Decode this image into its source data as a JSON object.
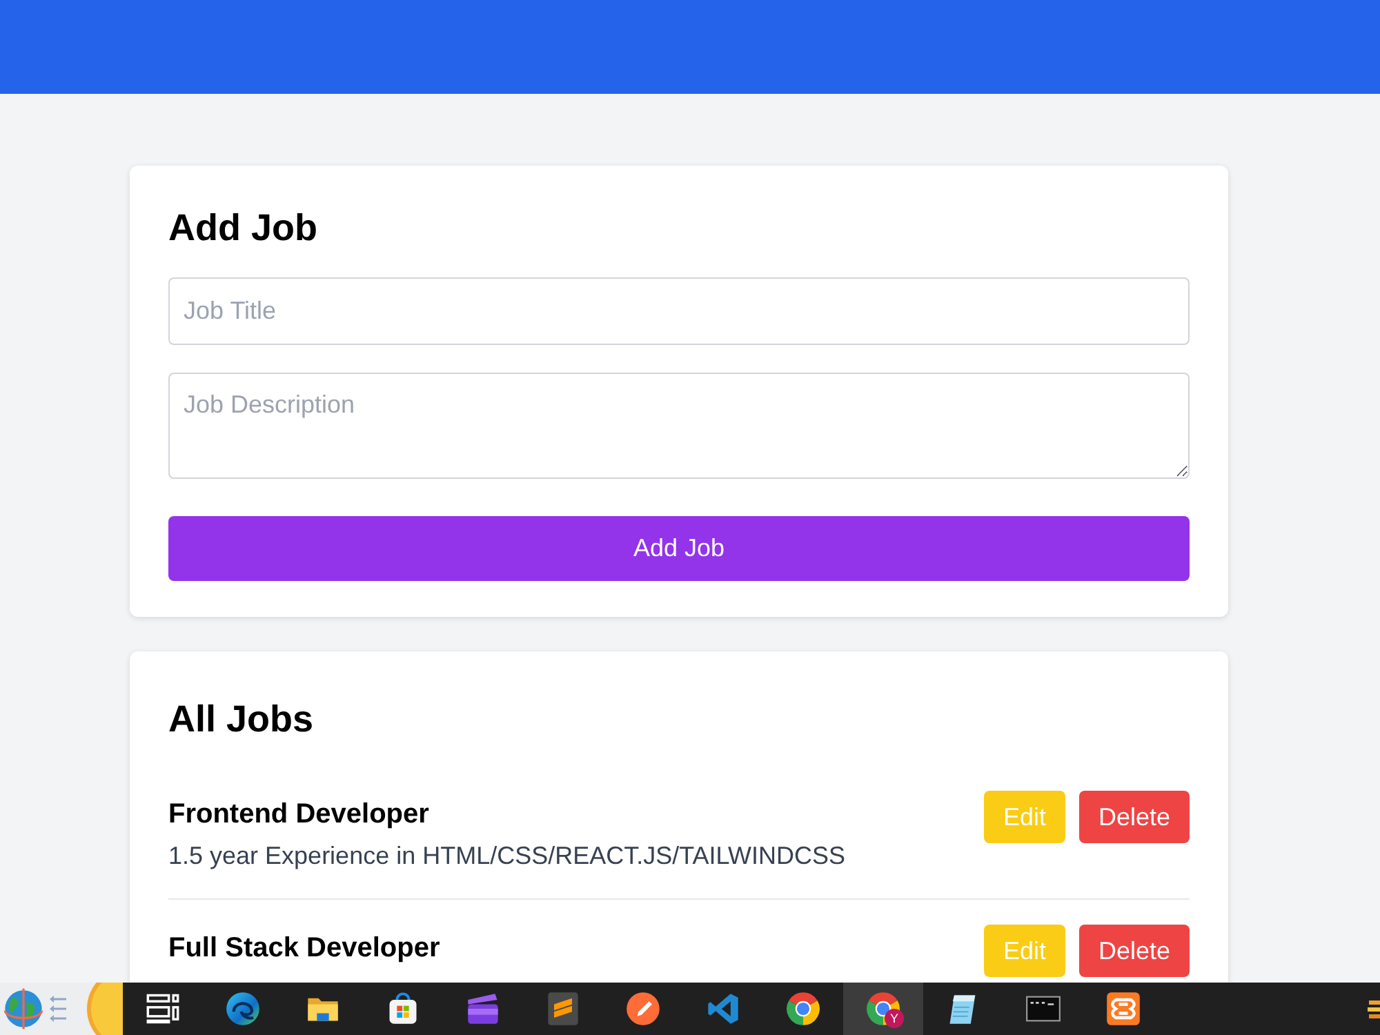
{
  "add_job": {
    "title": "Add Job",
    "fields": [
      {
        "kind": "input",
        "placeholder": "Job Title"
      },
      {
        "kind": "textarea",
        "placeholder": "Job Description"
      }
    ],
    "submit": "Add Job"
  },
  "all_jobs": {
    "title": "All Jobs",
    "jobs": [
      {
        "title": "Frontend Developer",
        "description": "1.5 year Experience in HTML/CSS/REACT.JS/TAILWINDCSS",
        "buttons": [
          {
            "kind": "edit",
            "label": "Edit"
          },
          {
            "kind": "delete",
            "label": "Delete"
          }
        ]
      },
      {
        "title": "Full Stack Developer",
        "buttons": [
          {
            "kind": "edit",
            "label": "Edit"
          },
          {
            "kind": "delete",
            "label": "Delete"
          }
        ]
      }
    ]
  },
  "taskbar": {
    "apps": [
      {
        "selected": false
      },
      {
        "selected": false
      },
      {
        "selected": false
      },
      {
        "selected": false
      },
      {
        "selected": false
      },
      {
        "selected": false
      },
      {
        "selected": false
      },
      {
        "selected": false
      },
      {
        "selected": false
      },
      {
        "selected": true,
        "badge": "Y"
      },
      {
        "selected": false
      },
      {
        "selected": false
      },
      {
        "selected": false
      }
    ]
  }
}
